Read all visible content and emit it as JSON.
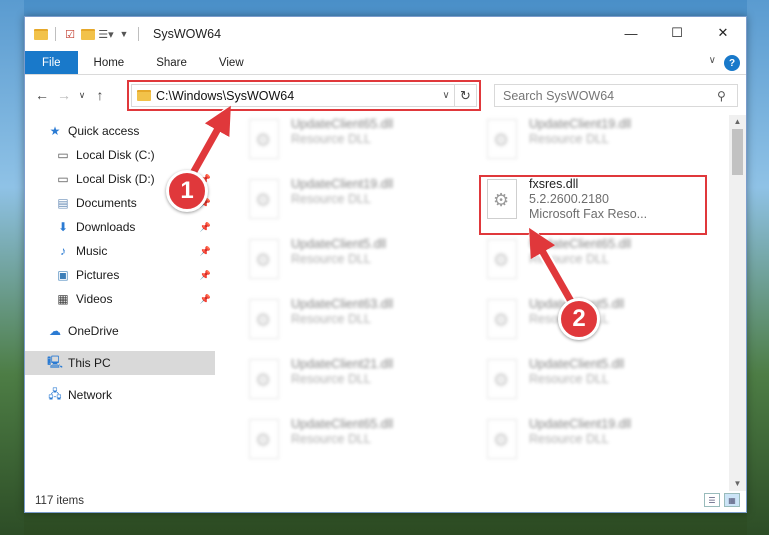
{
  "window": {
    "title": "SysWOW64"
  },
  "ribbon": {
    "tabs": [
      {
        "label": "File"
      },
      {
        "label": "Home"
      },
      {
        "label": "Share"
      },
      {
        "label": "View"
      }
    ],
    "help": "?"
  },
  "address": {
    "path": "C:\\Windows\\SysWOW64"
  },
  "search": {
    "placeholder": "Search SysWOW64"
  },
  "sidebar": {
    "items": [
      {
        "label": "Quick access",
        "icon": "star-icon",
        "pinned": false
      },
      {
        "label": "Local Disk (C:)",
        "icon": "drive-icon",
        "pinned": false
      },
      {
        "label": "Local Disk (D:)",
        "icon": "drive-icon",
        "pinned": false
      },
      {
        "label": "Documents",
        "icon": "documents-icon",
        "pinned": true
      },
      {
        "label": "Downloads",
        "icon": "download-icon",
        "pinned": true
      },
      {
        "label": "Music",
        "icon": "music-icon",
        "pinned": true
      },
      {
        "label": "Pictures",
        "icon": "pictures-icon",
        "pinned": true
      },
      {
        "label": "Videos",
        "icon": "videos-icon",
        "pinned": true
      },
      {
        "label": "OneDrive",
        "icon": "cloud-icon",
        "pinned": false
      },
      {
        "label": "This PC",
        "icon": "computer-icon",
        "pinned": false,
        "selected": true
      },
      {
        "label": "Network",
        "icon": "network-icon",
        "pinned": false
      }
    ]
  },
  "files": {
    "left_column": [
      {
        "name": "UpdateClient65.dll",
        "type": "Resource DLL"
      },
      {
        "name": "UpdateClient19.dll",
        "type": "Resource DLL"
      },
      {
        "name": "UpdateClient5.dll",
        "type": "Resource DLL"
      },
      {
        "name": "UpdateClient63.dll",
        "type": "Resource DLL"
      },
      {
        "name": "UpdateClient21.dll",
        "type": "Resource DLL"
      },
      {
        "name": "UpdateClient65.dll",
        "type": "Resource DLL"
      }
    ],
    "right_column": [
      {
        "name": "UpdateClient19.dll",
        "type": "Resource DLL"
      },
      {
        "name": "fxsres.dll",
        "version": "5.2.2600.2180",
        "description": "Microsoft  Fax Reso...",
        "highlighted": true
      },
      {
        "name": "UpdateClient65.dll",
        "type": "Resource DLL"
      },
      {
        "name": "UpdateClient5.dll",
        "type": "Resource DLL"
      },
      {
        "name": "UpdateClient5.dll",
        "type": "Resource DLL"
      },
      {
        "name": "UpdateClient19.dll",
        "type": "Resource DLL"
      }
    ]
  },
  "status": {
    "item_count": "117 items"
  },
  "annotations": {
    "step1": "1",
    "step2": "2",
    "color": "#e0383b"
  }
}
